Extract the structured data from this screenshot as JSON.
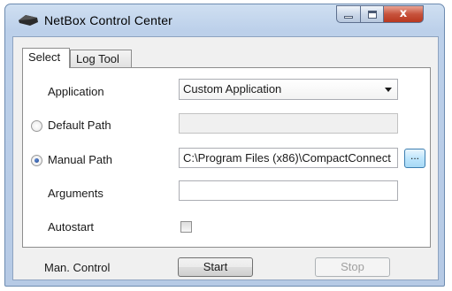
{
  "window": {
    "title": "NetBox Control Center",
    "title_icon": "netbox-app-icon",
    "close_glyph": "x",
    "colors": {
      "frame": "#bcd0ea",
      "close_button": "#c7533c",
      "browse_button": "#bee6fd"
    }
  },
  "tabs": [
    {
      "label": "Select",
      "active": true
    },
    {
      "label": "Log Tool",
      "active": false
    }
  ],
  "form": {
    "application": {
      "label": "Application",
      "value": "Custom Application"
    },
    "default_path": {
      "label": "Default Path",
      "selected": false,
      "value": ""
    },
    "manual_path": {
      "label": "Manual Path",
      "selected": true,
      "value": "C:\\Program Files (x86)\\CompactConnect",
      "browse_label": "..."
    },
    "arguments": {
      "label": "Arguments",
      "value": ""
    },
    "autostart": {
      "label": "Autostart",
      "checked": false
    }
  },
  "footer": {
    "label": "Man. Control",
    "start_label": "Start",
    "stop_label": "Stop",
    "stop_enabled": false
  }
}
